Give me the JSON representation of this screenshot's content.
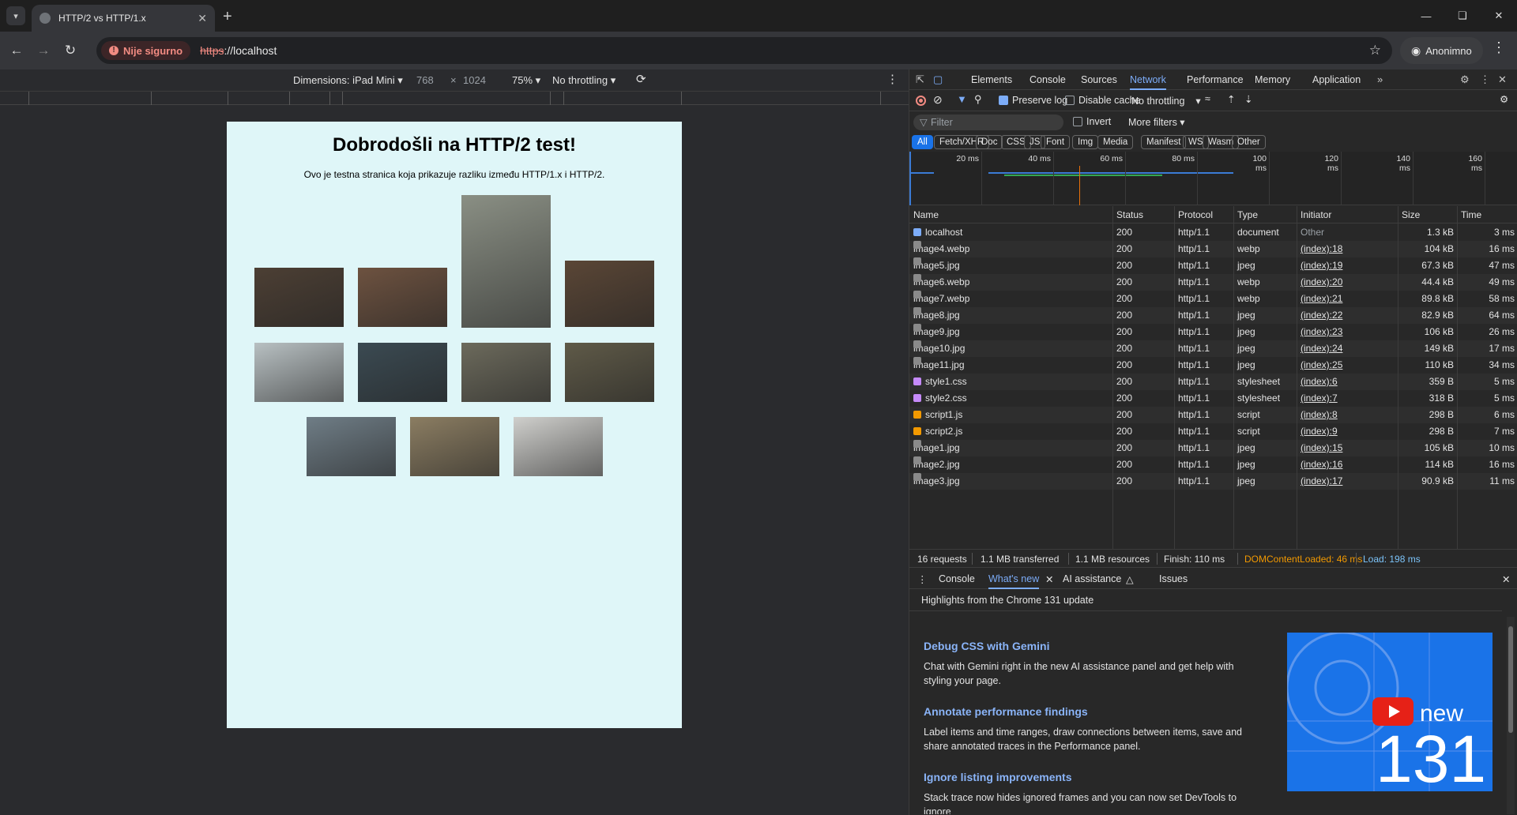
{
  "browser": {
    "tab_title": "HTTP/2 vs HTTP/1.x",
    "security_label": "Nije sigurno",
    "url_scheme": "https",
    "url_rest": "://localhost",
    "profile_label": "Anonimno"
  },
  "device_toolbar": {
    "dimensions_label": "Dimensions: iPad Mini ▾",
    "width": "768",
    "times": "×",
    "height": "1024",
    "zoom": "75% ▾",
    "throttling": "No throttling ▾"
  },
  "page": {
    "heading": "Dobrodošli na HTTP/2 test!",
    "subtitle": "Ovo je testna stranica koja prikazuje razliku između HTTP/1.x i HTTP/2."
  },
  "images": [
    {
      "name": "image-bag",
      "color": "#4c3f34"
    },
    {
      "name": "image-cat",
      "color": "#6d5240"
    },
    {
      "name": "image-pine",
      "color": "#8a8f84"
    },
    {
      "name": "image-man",
      "color": "#5a4636"
    },
    {
      "name": "image-sea",
      "color": "#b8c0c2"
    },
    {
      "name": "image-phone",
      "color": "#3b4a52"
    },
    {
      "name": "image-book",
      "color": "#6c6a5c"
    },
    {
      "name": "image-bird",
      "color": "#5f5a48"
    },
    {
      "name": "image-mountain",
      "color": "#6f7d86"
    },
    {
      "name": "image-elephant",
      "color": "#8b7d62"
    },
    {
      "name": "image-desk",
      "color": "#cfcfcc"
    }
  ],
  "devtools": {
    "tabs": [
      "Elements",
      "Console",
      "Sources",
      "Network",
      "Performance",
      "Memory",
      "Application"
    ],
    "preserve_log": "Preserve log",
    "disable_cache": "Disable cache",
    "throttling": "No throttling",
    "filter_placeholder": "Filter",
    "invert": "Invert",
    "more_filters": "More filters ▾",
    "type_filters": [
      "All",
      "Fetch/XHR",
      "Doc",
      "CSS",
      "JS",
      "Font",
      "Img",
      "Media",
      "Manifest",
      "WS",
      "Wasm",
      "Other"
    ],
    "timeline_ticks": [
      "20 ms",
      "40 ms",
      "60 ms",
      "80 ms",
      "100 ms",
      "120 ms",
      "140 ms",
      "160 ms"
    ],
    "columns": [
      "Name",
      "Status",
      "Protocol",
      "Type",
      "Initiator",
      "Size",
      "Time"
    ],
    "rows": [
      {
        "name": "localhost",
        "status": "200",
        "protocol": "http/1.1",
        "type": "document",
        "initiator": "Other",
        "size": "1.3 kB",
        "time": "3 ms",
        "kind": "doc"
      },
      {
        "name": "image4.webp",
        "status": "200",
        "protocol": "http/1.1",
        "type": "webp",
        "initiator": "(index):18",
        "size": "104 kB",
        "time": "16 ms",
        "kind": "img"
      },
      {
        "name": "image5.jpg",
        "status": "200",
        "protocol": "http/1.1",
        "type": "jpeg",
        "initiator": "(index):19",
        "size": "67.3 kB",
        "time": "47 ms",
        "kind": "img"
      },
      {
        "name": "image6.webp",
        "status": "200",
        "protocol": "http/1.1",
        "type": "webp",
        "initiator": "(index):20",
        "size": "44.4 kB",
        "time": "49 ms",
        "kind": "img"
      },
      {
        "name": "image7.webp",
        "status": "200",
        "protocol": "http/1.1",
        "type": "webp",
        "initiator": "(index):21",
        "size": "89.8 kB",
        "time": "58 ms",
        "kind": "img"
      },
      {
        "name": "image8.jpg",
        "status": "200",
        "protocol": "http/1.1",
        "type": "jpeg",
        "initiator": "(index):22",
        "size": "82.9 kB",
        "time": "64 ms",
        "kind": "img"
      },
      {
        "name": "image9.jpg",
        "status": "200",
        "protocol": "http/1.1",
        "type": "jpeg",
        "initiator": "(index):23",
        "size": "106 kB",
        "time": "26 ms",
        "kind": "img"
      },
      {
        "name": "image10.jpg",
        "status": "200",
        "protocol": "http/1.1",
        "type": "jpeg",
        "initiator": "(index):24",
        "size": "149 kB",
        "time": "17 ms",
        "kind": "img"
      },
      {
        "name": "image11.jpg",
        "status": "200",
        "protocol": "http/1.1",
        "type": "jpeg",
        "initiator": "(index):25",
        "size": "110 kB",
        "time": "34 ms",
        "kind": "img"
      },
      {
        "name": "style1.css",
        "status": "200",
        "protocol": "http/1.1",
        "type": "stylesheet",
        "initiator": "(index):6",
        "size": "359 B",
        "time": "5 ms",
        "kind": "css"
      },
      {
        "name": "style2.css",
        "status": "200",
        "protocol": "http/1.1",
        "type": "stylesheet",
        "initiator": "(index):7",
        "size": "318 B",
        "time": "5 ms",
        "kind": "css"
      },
      {
        "name": "script1.js",
        "status": "200",
        "protocol": "http/1.1",
        "type": "script",
        "initiator": "(index):8",
        "size": "298 B",
        "time": "6 ms",
        "kind": "js"
      },
      {
        "name": "script2.js",
        "status": "200",
        "protocol": "http/1.1",
        "type": "script",
        "initiator": "(index):9",
        "size": "298 B",
        "time": "7 ms",
        "kind": "js"
      },
      {
        "name": "image1.jpg",
        "status": "200",
        "protocol": "http/1.1",
        "type": "jpeg",
        "initiator": "(index):15",
        "size": "105 kB",
        "time": "10 ms",
        "kind": "img"
      },
      {
        "name": "image2.jpg",
        "status": "200",
        "protocol": "http/1.1",
        "type": "jpeg",
        "initiator": "(index):16",
        "size": "114 kB",
        "time": "16 ms",
        "kind": "img"
      },
      {
        "name": "image3.jpg",
        "status": "200",
        "protocol": "http/1.1",
        "type": "jpeg",
        "initiator": "(index):17",
        "size": "90.9 kB",
        "time": "11 ms",
        "kind": "img"
      }
    ],
    "summary": {
      "requests": "16 requests",
      "transferred": "1.1 MB transferred",
      "resources": "1.1 MB resources",
      "finish": "Finish: 110 ms",
      "dcl": "DOMContentLoaded: 46 ms",
      "load": "Load: 198 ms"
    },
    "drawer_tabs": [
      "Console",
      "What's new",
      "AI assistance",
      "Issues"
    ],
    "whats_new": {
      "header": "Highlights from the Chrome 131 update",
      "items": [
        {
          "title": "Debug CSS with Gemini",
          "text": "Chat with Gemini right in the new AI assistance panel and get help with styling your page."
        },
        {
          "title": "Annotate performance findings",
          "text": "Label items and time ranges, draw connections between items, save and share annotated traces in the Performance panel."
        },
        {
          "title": "Ignore listing improvements",
          "text": "Stack trace now hides ignored frames and you can now set DevTools to ignore"
        }
      ],
      "banner_new": "new",
      "banner_version": "131"
    }
  }
}
